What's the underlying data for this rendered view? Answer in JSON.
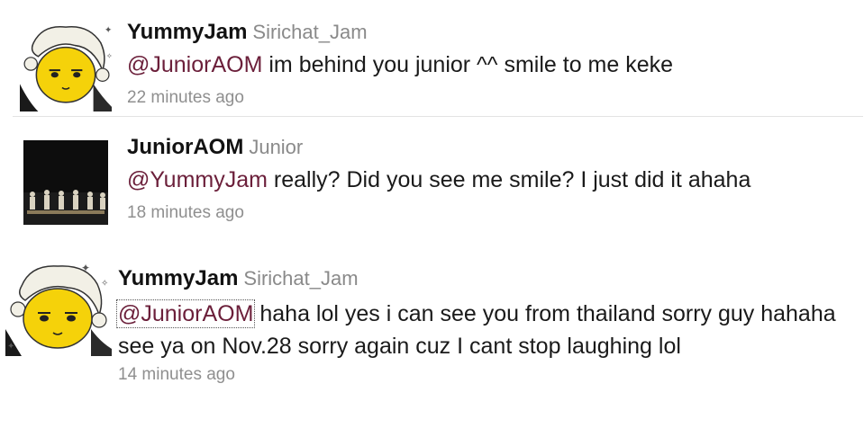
{
  "tweets": [
    {
      "username": "YummyJam",
      "realname": "Sirichat_Jam",
      "mention": "@JuniorAOM",
      "text": " im behind you junior ^^ smile to me keke",
      "time": "22 minutes ago",
      "avatar": "cartoon-face-icon"
    },
    {
      "username": "JuniorAOM",
      "realname": "Junior",
      "mention": "@YummyJam",
      "text": " really? Did you see me smile? I just did it ahaha",
      "time": "18 minutes ago",
      "avatar": "band-stage-photo"
    },
    {
      "username": "YummyJam",
      "realname": "Sirichat_Jam",
      "mention": "@JuniorAOM",
      "text": " haha lol yes i can see you from thailand sorry guy hahaha see ya on Nov.28 sorry again cuz I cant stop laughing lol",
      "time": "14 minutes ago",
      "avatar": "cartoon-face-icon"
    }
  ],
  "colors": {
    "mention": "#6b1f3a",
    "username": "#121212",
    "realname": "#8a8a8a",
    "timestamp": "#8f8f8f",
    "avatar_face": "#f5d20a"
  }
}
